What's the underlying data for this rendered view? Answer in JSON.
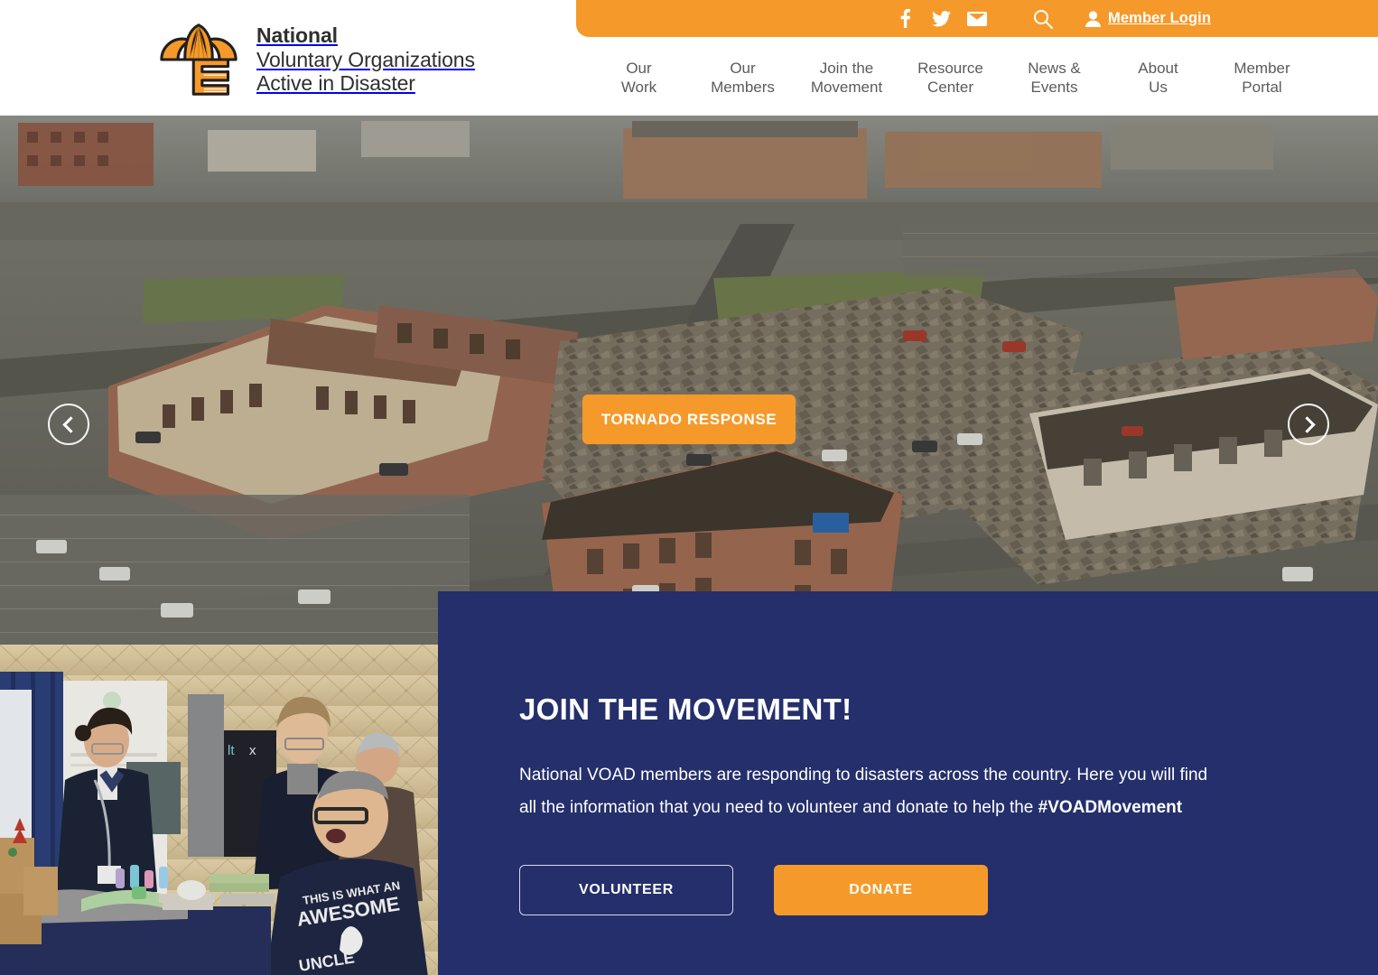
{
  "brand": {
    "logo_icon": "voad-tree-logo-icon",
    "line1": "National",
    "line2": "Voluntary Organizations",
    "line3": "Active in Disaster",
    "accent_orange": "#f59a2a",
    "accent_blue": "#242f6b"
  },
  "utility_bar": {
    "facebook_icon": "facebook-icon",
    "twitter_icon": "twitter-icon",
    "email_icon": "email-icon",
    "search_icon": "search-icon",
    "member_icon": "user-icon",
    "member_login_label": "Member Login"
  },
  "nav": {
    "items": [
      {
        "label": "Our\nWork"
      },
      {
        "label": "Our\nMembers"
      },
      {
        "label": "Join the\nMovement"
      },
      {
        "label": "Resource\nCenter"
      },
      {
        "label": "News &\nEvents"
      },
      {
        "label": "About\nUs"
      },
      {
        "label": "Member\nPortal"
      }
    ]
  },
  "hero": {
    "slide_cta_label": "TORNADO RESPONSE",
    "prev_icon": "chevron-left-icon",
    "next_icon": "chevron-right-icon",
    "image_alt": "Aerial view of a town destroyed by a tornado"
  },
  "conference_photo": {
    "image_alt": "People talking at a National VOAD conference exhibit booth"
  },
  "join": {
    "title": "JOIN THE MOVEMENT!",
    "body_part1": "National VOAD members are responding to disasters across the country. Here you will find all the information that you need to volunteer and donate to help the ",
    "hashtag": "#VOADMovement",
    "volunteer_label": "VOLUNTEER",
    "donate_label": "DONATE"
  }
}
